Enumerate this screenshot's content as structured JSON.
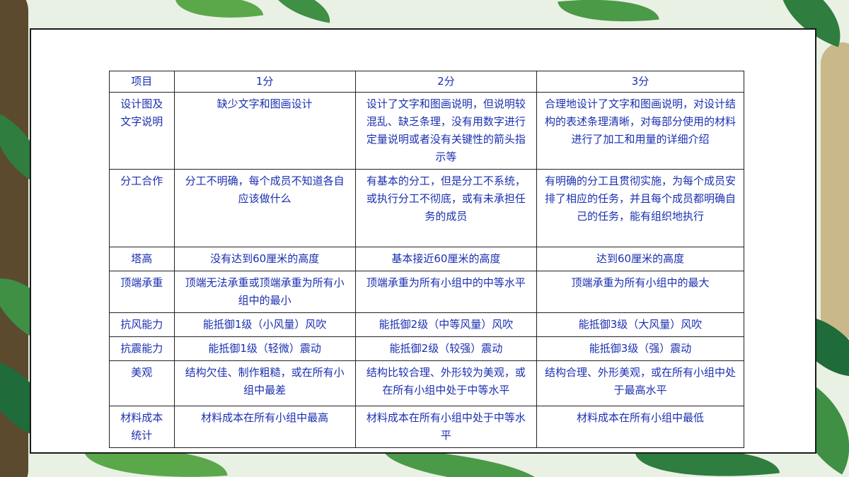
{
  "colors": {
    "text": "#1a2fb0",
    "border": "#222222",
    "card_border": "#1a1a1a",
    "leaf_dark": "#1f6b3a",
    "leaf_light": "#5aa84a"
  },
  "table": {
    "headers": [
      "项目",
      "1分",
      "2分",
      "3分"
    ],
    "rows": [
      {
        "item": "设计图及文字说明",
        "score1": "缺少文字和图画设计",
        "score2": "设计了文字和图画说明，但说明较混乱、缺乏条理，没有用数字进行定量说明或者没有关键性的箭头指示等",
        "score3": "合理地设计了文字和图画说明，对设计结构的表述条理清晰，对每部分使用的材料进行了加工和用量的详细介绍"
      },
      {
        "item": "分工合作",
        "score1": "分工不明确，每个成员不知道各自应该做什么",
        "score2": "有基本的分工，但是分工不系统，或执行分工不彻底，或有未承担任务的成员",
        "score3": "有明确的分工且贯彻实施，为每个成员安排了相应的任务，并且每个成员都明确自己的任务，能有组织地执行"
      },
      {
        "item": "塔高",
        "score1": "没有达到60厘米的高度",
        "score2": "基本接近60厘米的高度",
        "score3": "达到60厘米的高度"
      },
      {
        "item": "顶端承重",
        "score1": "顶端无法承重或顶端承重为所有小组中的最小",
        "score2": "顶端承重为所有小组中的中等水平",
        "score3": "顶端承重为所有小组中的最大"
      },
      {
        "item": "抗风能力",
        "score1": "能抵御1级（小风量）风吹",
        "score2": "能抵御2级（中等风量）风吹",
        "score3": "能抵御3级（大风量）风吹"
      },
      {
        "item": "抗震能力",
        "score1": "能抵御1级（轻微）震动",
        "score2": "能抵御2级（较强）震动",
        "score3": "能抵御3级（强）震动"
      },
      {
        "item": "美观",
        "score1": "结构欠佳、制作粗糙，或在所有小组中最差",
        "score2": "结构比较合理、外形较为美观，或在所有小组中处于中等水平",
        "score3": "结构合理、外形美观，或在所有小组中处于最高水平"
      },
      {
        "item": "材料成本统计",
        "score1": "材料成本在所有小组中最高",
        "score2": "材料成本在所有小组中处于中等水平",
        "score3": "材料成本在所有小组中最低"
      }
    ]
  }
}
